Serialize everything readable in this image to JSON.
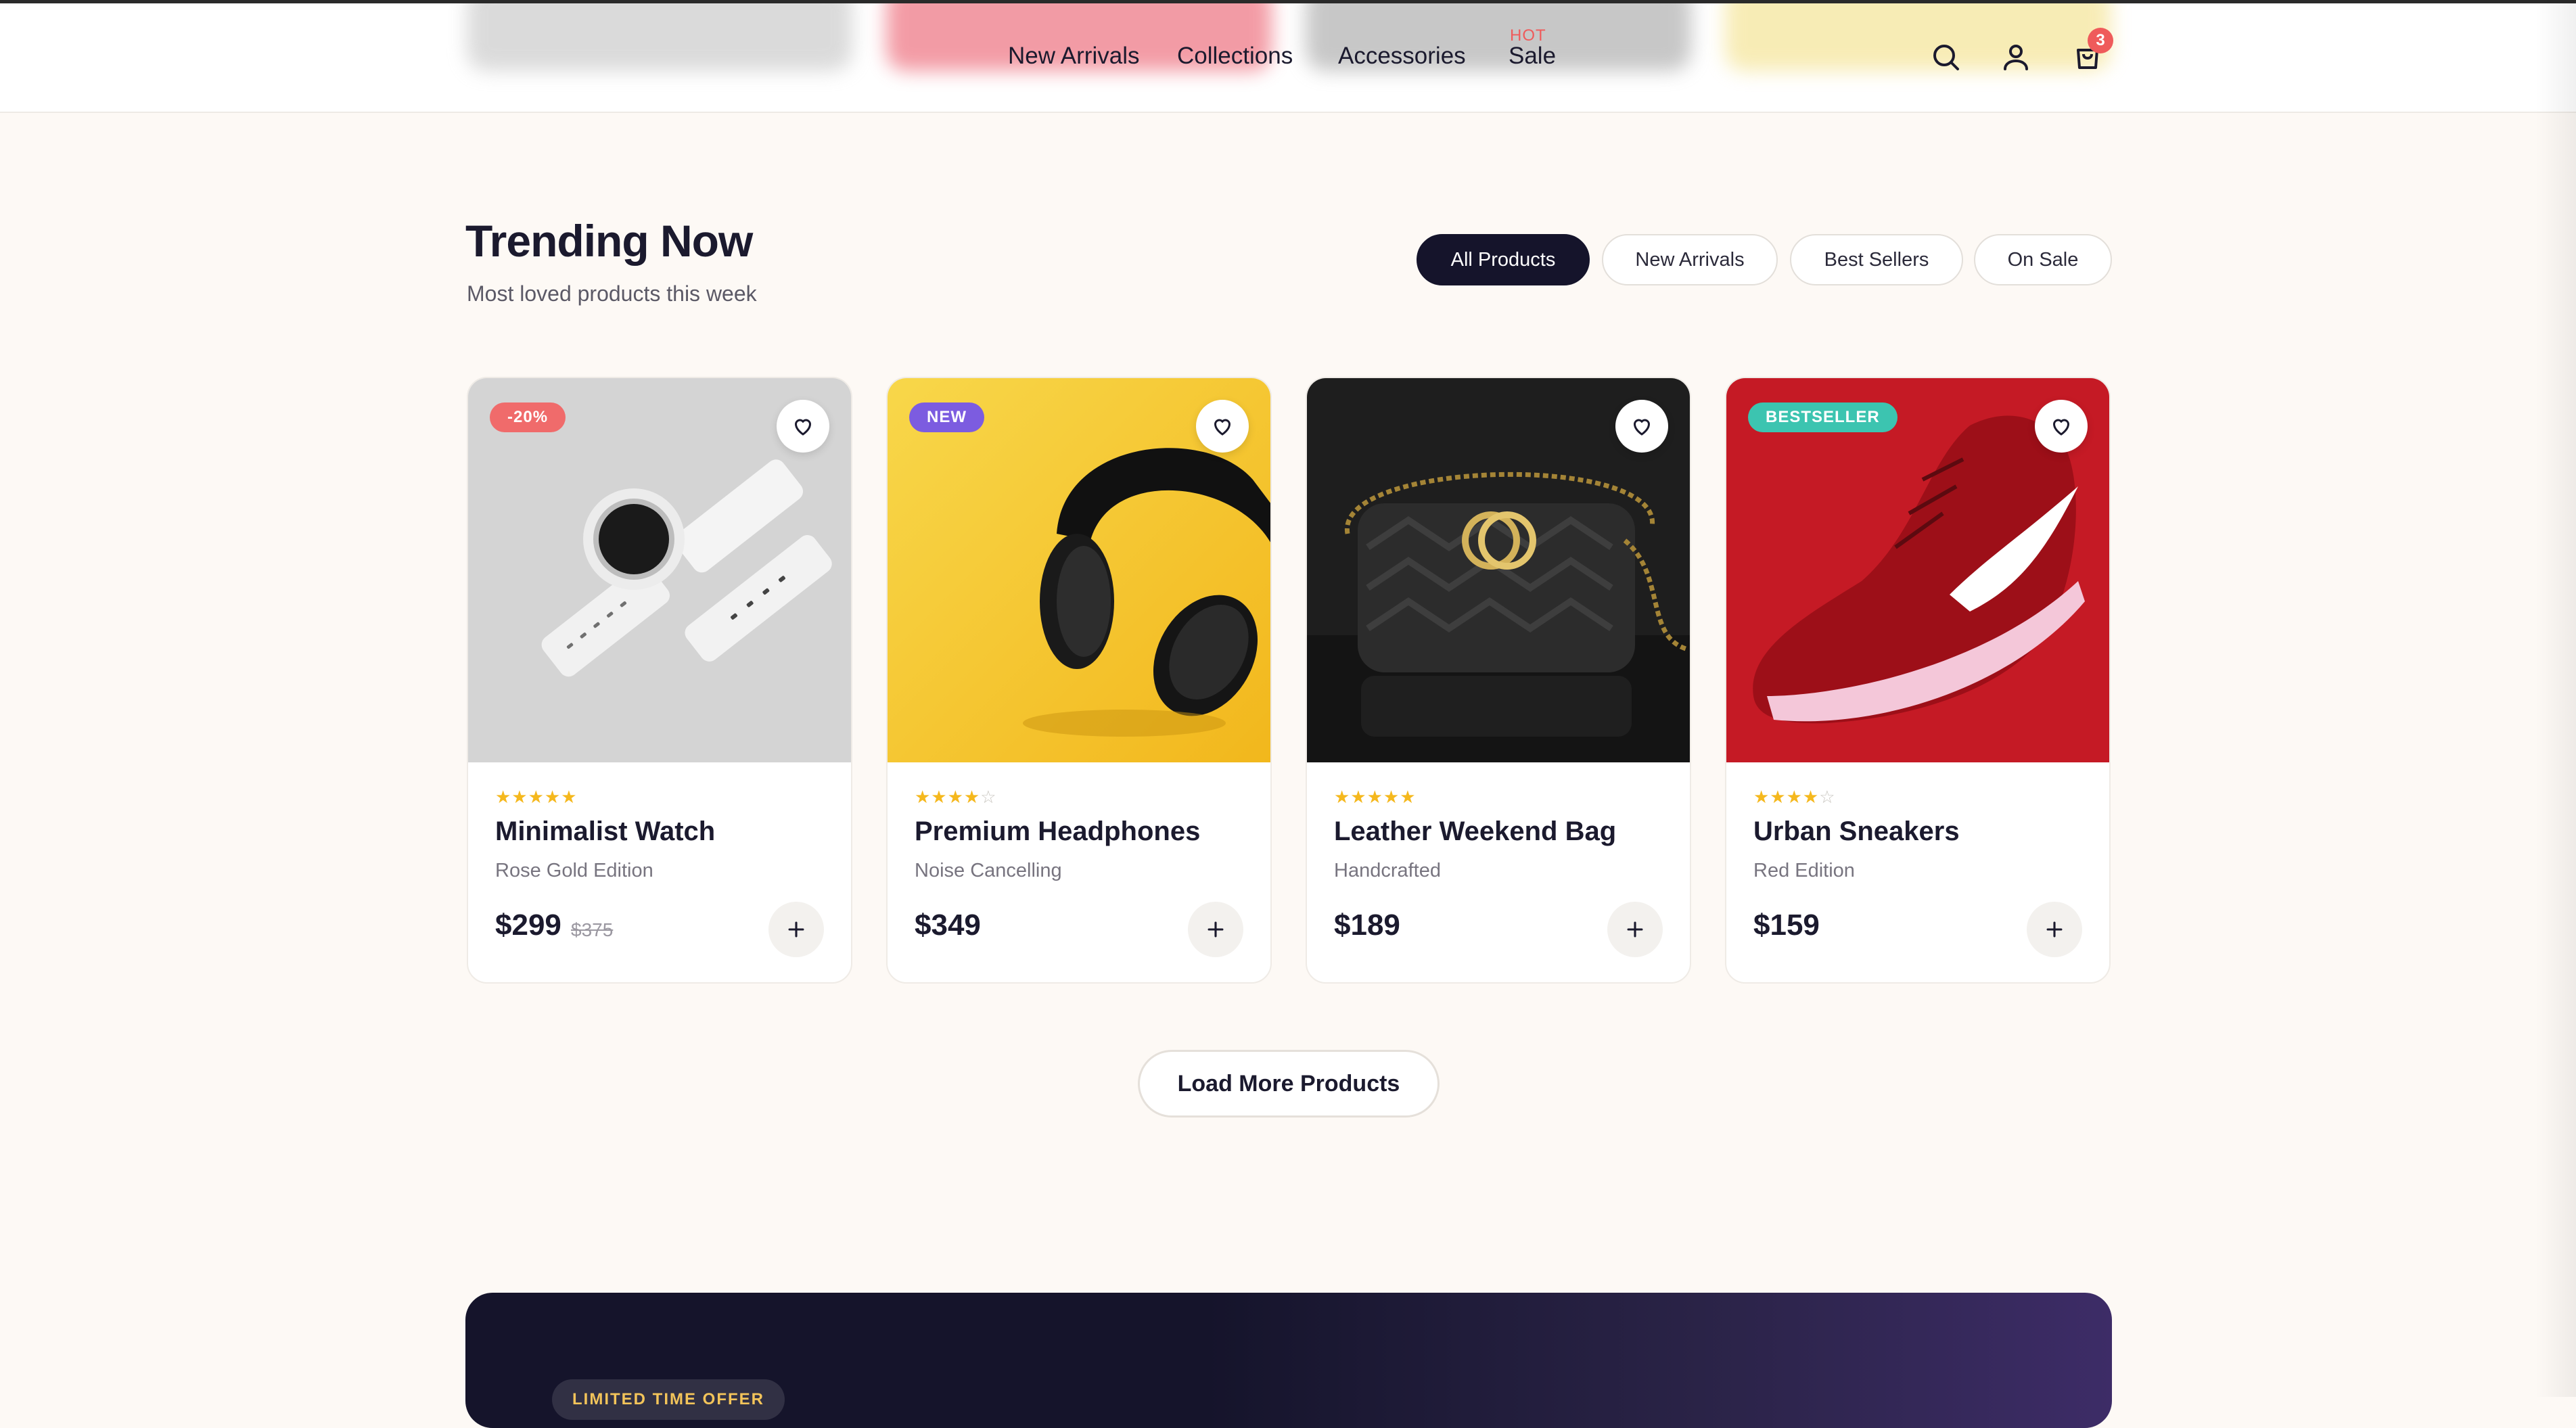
{
  "nav": {
    "links": [
      "New Arrivals",
      "Collections",
      "Accessories",
      "Sale"
    ],
    "hot_tag": "HOT",
    "cart_count": "3",
    "icons": [
      "search-icon",
      "user-icon",
      "cart-icon"
    ]
  },
  "section": {
    "title": "Trending Now",
    "subtitle": "Most loved products this week",
    "filters": [
      "All Products",
      "New Arrivals",
      "Best Sellers",
      "On Sale"
    ],
    "active_filter": "All Products"
  },
  "products": [
    {
      "badge": "-20%",
      "badge_color": "#f06b6b",
      "rating": 5,
      "name": "Minimalist Watch",
      "variant": "Rose Gold Edition",
      "price": "$299",
      "old_price": "$375",
      "image": "watch"
    },
    {
      "badge": "NEW",
      "badge_color": "#7c5ce0",
      "rating": 4,
      "name": "Premium Headphones",
      "variant": "Noise Cancelling",
      "price": "$349",
      "old_price": "",
      "image": "headphones"
    },
    {
      "badge": "",
      "badge_color": "",
      "rating": 5,
      "name": "Leather Weekend Bag",
      "variant": "Handcrafted",
      "price": "$189",
      "old_price": "",
      "image": "bag"
    },
    {
      "badge": "BESTSELLER",
      "badge_color": "#3cc4b0",
      "rating": 4,
      "name": "Urban Sneakers",
      "variant": "Red Edition",
      "price": "$159",
      "old_price": "",
      "image": "sneaker"
    }
  ],
  "load_more_label": "Load More Products",
  "promo": {
    "tag": "LIMITED TIME OFFER"
  },
  "colors": {
    "accent_dark": "#15142b",
    "sale_red": "#ef5b5b",
    "star_gold": "#f5b81d",
    "page_bg": "#fdf9f5"
  }
}
